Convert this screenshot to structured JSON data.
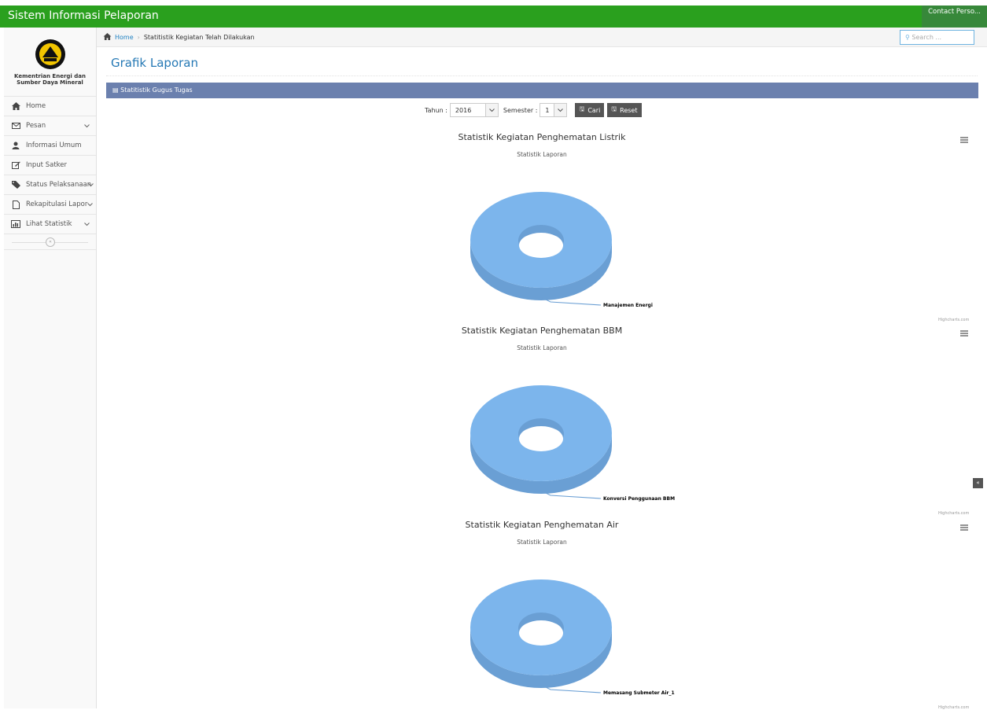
{
  "app": {
    "title": "Sistem Informasi Pelaporan",
    "contact": "Contact Perso..."
  },
  "sidebar": {
    "logo_line1": "Kementrian Energi dan",
    "logo_line2": "Sumber Daya Mineral",
    "items": [
      {
        "label": "Home",
        "icon": "home-icon"
      },
      {
        "label": "Pesan",
        "icon": "envelope-icon"
      },
      {
        "label": "Informasi Umum",
        "icon": "user-icon"
      },
      {
        "label": "Input Satker",
        "icon": "edit-icon"
      },
      {
        "label": "Status Pelaksanaan",
        "icon": "tag-icon"
      },
      {
        "label": "Rekapitulasi Lapor",
        "icon": "file-icon"
      },
      {
        "label": "Lihat Statistik",
        "icon": "bar-chart-icon"
      }
    ]
  },
  "breadcrumb": {
    "home": "Home",
    "current": "Statitistik Kegiatan Telah Dilakukan"
  },
  "search": {
    "placeholder": "Search ..."
  },
  "page": {
    "title": "Grafik Laporan",
    "widget_title": "Statitistik Gugus Tugas"
  },
  "filter": {
    "year_label": "Tahun :",
    "year_value": "2016",
    "semester_label": "Semester :",
    "semester_value": "1",
    "search_button": "Cari",
    "reset_button": "Reset"
  },
  "colors": {
    "navbar": "#2aa01e",
    "widget_header": "#6b80ae",
    "pie_fill": "#7cb5ec",
    "pie_side": "#6a9fd4"
  },
  "chart_data": [
    {
      "type": "pie",
      "title": "Statistik Kegiatan Penghematan Listrik",
      "subtitle": "Statistik Laporan",
      "categories": [
        "Manajemen Energi"
      ],
      "values": [
        100
      ],
      "credit": "Highcharts.com"
    },
    {
      "type": "pie",
      "title": "Statistik Kegiatan Penghematan BBM",
      "subtitle": "Statistik Laporan",
      "categories": [
        "Konversi Penggunaan BBM"
      ],
      "values": [
        100
      ],
      "credit": "Highcharts.com"
    },
    {
      "type": "pie",
      "title": "Statistik Kegiatan Penghematan Air",
      "subtitle": "Statistik Laporan",
      "categories": [
        "Memasang Submeter Air_1"
      ],
      "values": [
        100
      ],
      "credit": "Highcharts.com"
    }
  ]
}
